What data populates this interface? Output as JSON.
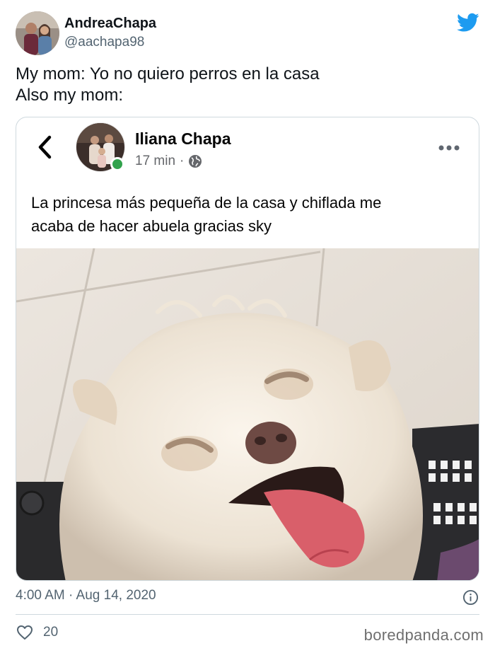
{
  "tweet": {
    "author": {
      "display_name": "AndreaChapa",
      "handle": "@aachapa98"
    },
    "text_lines": [
      "My mom: Yo no quiero perros en la casa",
      "Also my mom:"
    ],
    "timestamp": "4:00 AM · Aug 14, 2020",
    "likes": "20"
  },
  "embedded_post": {
    "author_name": "Iliana Chapa",
    "time": "17 min",
    "separator": "·",
    "text_lines": [
      "La princesa más pequeña de la casa y chiflada me",
      "acaba de hacer abuela gracias sky"
    ]
  },
  "watermark": "boredpanda.com",
  "colors": {
    "twitter_blue": "#1d9bf0",
    "online_green": "#31a24c",
    "secondary_text": "#536471",
    "border": "#cfd9de"
  },
  "icons": {
    "brand": "twitter-bird-icon",
    "back": "chevron-left-icon",
    "privacy": "globe-icon",
    "more": "more-horizontal-icon",
    "info": "info-icon",
    "like": "heart-icon"
  }
}
